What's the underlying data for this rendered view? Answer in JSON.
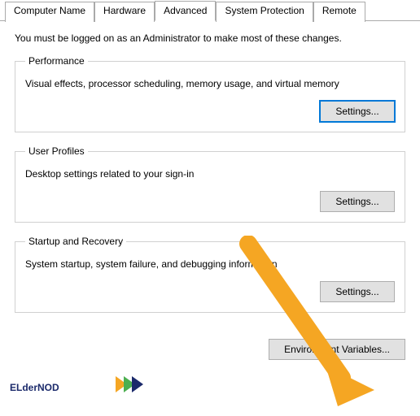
{
  "tabs": [
    {
      "label": "Computer Name"
    },
    {
      "label": "Hardware"
    },
    {
      "label": "Advanced"
    },
    {
      "label": "System Protection"
    },
    {
      "label": "Remote"
    }
  ],
  "active_tab": 2,
  "intro": "You must be logged on as an Administrator to make most of these changes.",
  "groups": {
    "performance": {
      "legend": "Performance",
      "desc": "Visual effects, processor scheduling, memory usage, and virtual memory",
      "button": "Settings..."
    },
    "user_profiles": {
      "legend": "User Profiles",
      "desc": "Desktop settings related to your sign-in",
      "button": "Settings..."
    },
    "startup": {
      "legend": "Startup and Recovery",
      "desc": "System startup, system failure, and debugging information",
      "button": "Settings..."
    }
  },
  "env_button": "Environment Variables...",
  "logo": {
    "text1": "ELder",
    "text2": "NOD",
    "accent_colors": {
      "navy": "#1b2a6b",
      "orange": "#f5a623",
      "green": "#4caf50",
      "blue": "#1b2a6b"
    }
  },
  "arrow_color": "#f5a623"
}
